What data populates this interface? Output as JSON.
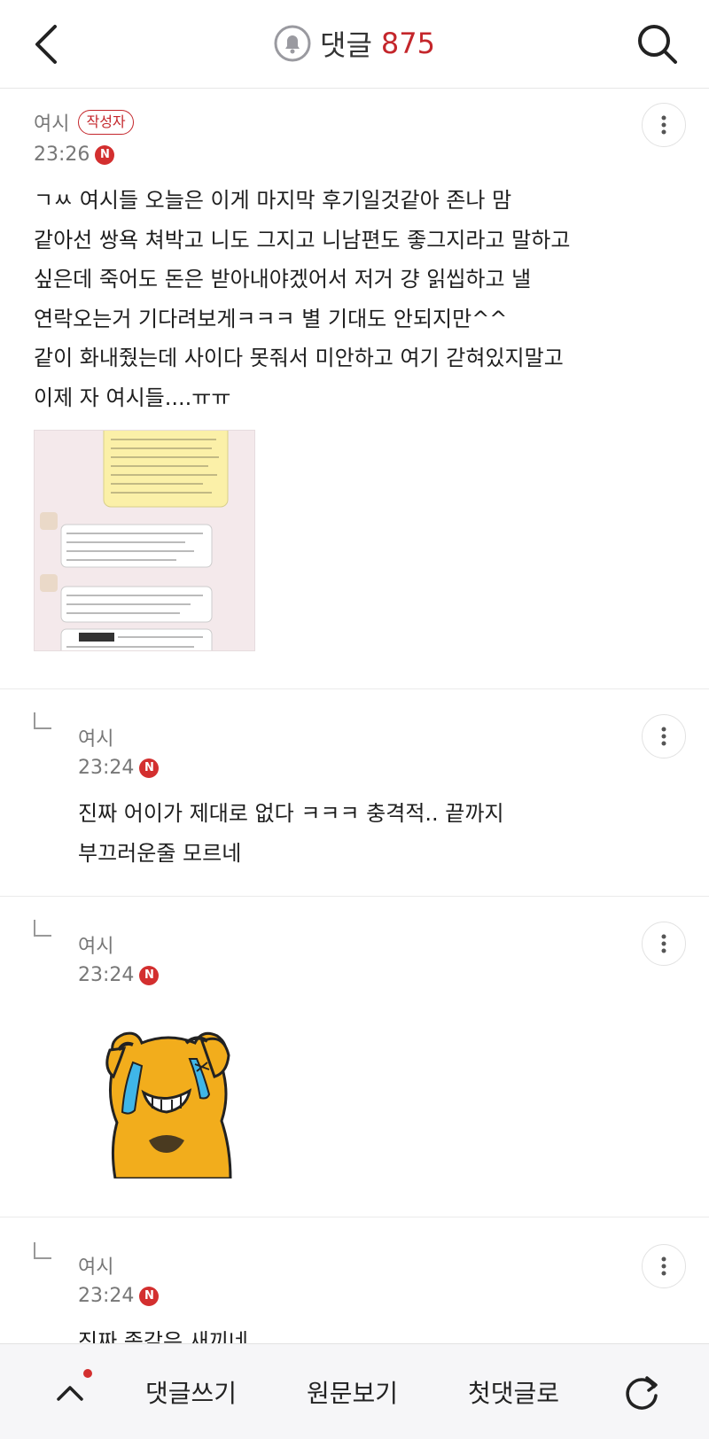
{
  "header": {
    "title": "댓글",
    "count": "875",
    "back_icon": "chevron-left-icon",
    "search_icon": "search-icon",
    "bell_icon": "bell-icon"
  },
  "comments": [
    {
      "author": "여시",
      "badge": "작성자",
      "time": "23:26",
      "new_badge": "N",
      "text": "ㄱㅆ 여시들 오늘은 이게 마지막 후기일것같아 존나 맘\n같아선 쌍욕 쳐박고 니도 그지고 니남편도 좋그지라고 말하고\n싶은데 죽어도 돈은 받아내야겠어서 저거 걍 읽씹하고 낼\n연락오는거 기다려보게ㅋㅋㅋ 별 기대도 안되지만^^\n같이 화내줬는데 사이다 못줘서 미안하고 여기 갇혀있지말고\n이제 자 여시들....ㅠㅠ",
      "image": "chat-screenshot"
    },
    {
      "author": "여시",
      "time": "23:24",
      "new_badge": "N",
      "text": "진짜 어이가 제대로 없다 ㅋㅋㅋ 충격적.. 끝까지\n부끄러운줄 모르네"
    },
    {
      "author": "여시",
      "time": "23:24",
      "new_badge": "N",
      "image": "crying-bear-emoticon"
    },
    {
      "author": "여시",
      "time": "23:24",
      "new_badge": "N",
      "text": "진짜 좃같은 새끼네"
    }
  ],
  "bottom_bar": {
    "up_icon": "chevron-up-icon",
    "write": "댓글쓰기",
    "original": "원문보기",
    "first": "첫댓글로",
    "refresh_icon": "refresh-icon"
  },
  "colors": {
    "accent": "#c4262b",
    "new_badge": "#d32f2f",
    "meta_text": "#777777"
  }
}
